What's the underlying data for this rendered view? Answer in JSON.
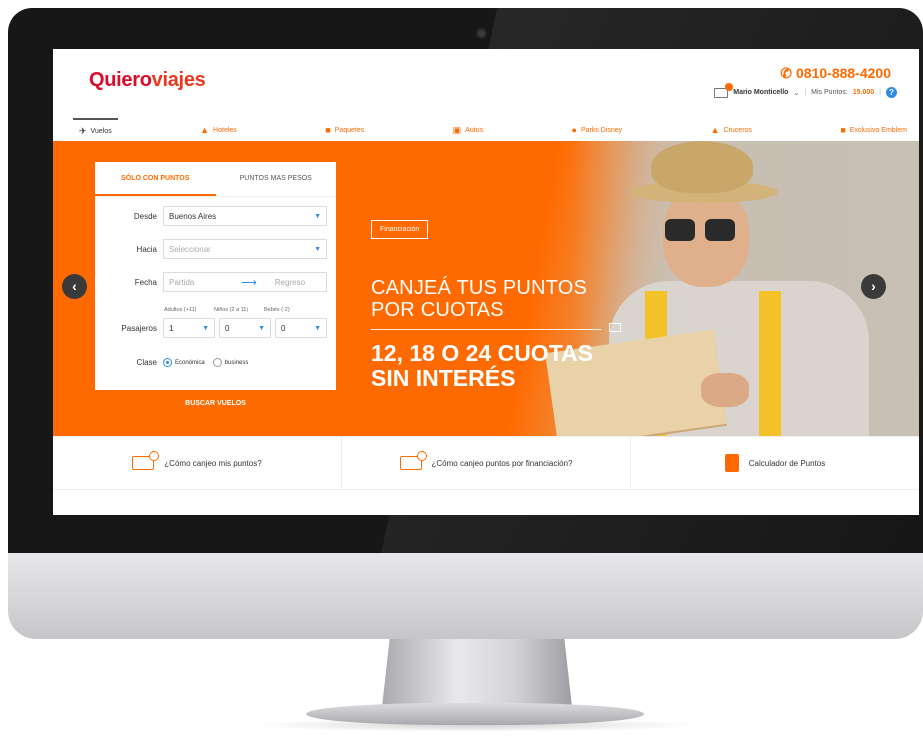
{
  "brand": {
    "logo_part1": "Quiero",
    "logo_part2": "viajes"
  },
  "header": {
    "phone_icon": "phone-icon",
    "phone": "0810-888-4200",
    "user_name": "Mario Monticello",
    "points_label": "Mis Puntos:",
    "points_value": "15.000",
    "help_icon": "question-icon"
  },
  "nav": {
    "items": [
      {
        "label": "Vuelos",
        "icon": "plane-icon"
      },
      {
        "label": "Hoteles",
        "icon": "hotel-icon"
      },
      {
        "label": "Paquetes",
        "icon": "suitcase-icon"
      },
      {
        "label": "Autos",
        "icon": "car-icon"
      },
      {
        "label": "Parks Disney",
        "icon": "mickey-icon"
      },
      {
        "label": "Cruceros",
        "icon": "ship-icon"
      },
      {
        "label": "Exclusivo Emblem",
        "icon": "lock-icon"
      }
    ]
  },
  "search": {
    "tab_points": "SÓLO CON PUNTOS",
    "tab_points_money": "PUNTOS MAS PESOS",
    "desde_label": "Desde",
    "desde_value": "Buenos Aires",
    "hacia_label": "Hacia",
    "hacia_placeholder": "Seleccionar",
    "fecha_label": "Fecha",
    "partida_placeholder": "Partida",
    "regreso_placeholder": "Regreso",
    "adultos_label": "Adultos (+11)",
    "ninos_label": "Niños (2 a 11)",
    "bebes_label": "Bebés (-2)",
    "pasajeros_label": "Pasajeros",
    "adultos_value": "1",
    "ninos_value": "0",
    "bebes_value": "0",
    "clase_label": "Clase",
    "clase_economica": "Económica",
    "clase_business": "business",
    "buscar_button": "BUSCAR VUELOS"
  },
  "hero": {
    "badge": "Financiación",
    "headline1_line1": "CANJEÁ TUS PUNTOS",
    "headline1_line2": "POR CUOTAS",
    "headline2_line1": "12, 18 O 24 CUOTAS",
    "headline2_line2": "SIN INTERÉS",
    "slides_count": 5,
    "active_slide": 1
  },
  "info": {
    "item1": "¿Cómo canjeo mis puntos?",
    "item2": "¿Cómo canjeo puntos por financiación?",
    "item3": "Calculador de Puntos"
  },
  "colors": {
    "accent": "#ff6a00",
    "logo_red": "#d90c2b",
    "link_blue": "#2f8ce0"
  }
}
